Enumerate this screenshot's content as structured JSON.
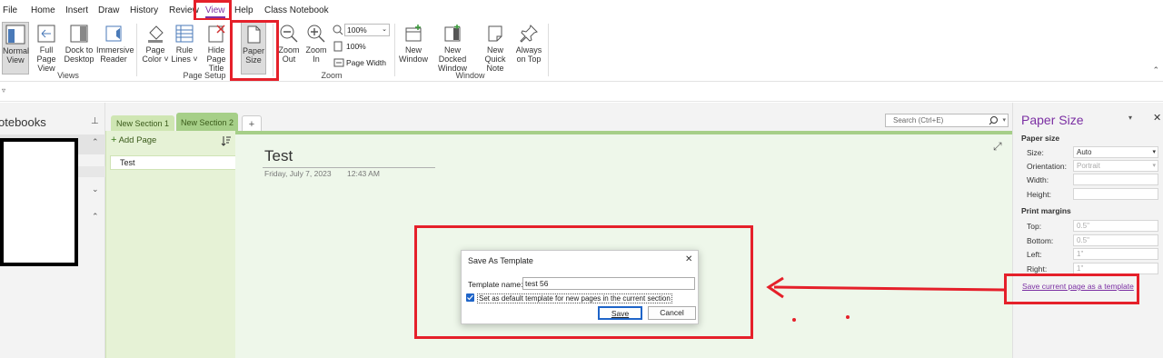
{
  "menu": {
    "items": [
      "File",
      "Home",
      "Insert",
      "Draw",
      "History",
      "Review",
      "View",
      "Help",
      "Class Notebook"
    ],
    "active": "View"
  },
  "ribbon": {
    "views": {
      "label": "Views",
      "normal": [
        "Normal",
        "View"
      ],
      "full_page": [
        "Full Page",
        "View"
      ],
      "dock": [
        "Dock to",
        "Desktop"
      ],
      "immersive": [
        "Immersive",
        "Reader"
      ]
    },
    "page_setup": {
      "label": "Page Setup",
      "page_color": [
        "Page",
        "Color ˅"
      ],
      "rule_lines": [
        "Rule",
        "Lines ˅"
      ],
      "hide_title": [
        "Hide",
        "Page Title"
      ],
      "paper_size": [
        "Paper",
        "Size"
      ]
    },
    "zoom": {
      "label": "Zoom",
      "zoom_out": [
        "Zoom",
        "Out"
      ],
      "zoom_in": [
        "Zoom",
        "In"
      ],
      "zoom_value": "100%",
      "hundred": "100%",
      "page_width": "Page Width"
    },
    "window": {
      "label": "Window",
      "new_window": [
        "New",
        "Window"
      ],
      "new_docked": [
        "New Docked",
        "Window"
      ],
      "quick_note": [
        "New Quick",
        "Note"
      ],
      "always_top": [
        "Always",
        "on Top"
      ]
    }
  },
  "notebooks_title": "otebooks",
  "sections": {
    "tabs": [
      "New Section 1",
      "New Section 2"
    ],
    "add_tab": "+",
    "active_index": 1
  },
  "search": {
    "placeholder": "Search (Ctrl+E)"
  },
  "pages": {
    "add_page": "Add Page",
    "items": [
      "Test"
    ]
  },
  "page": {
    "title": "Test",
    "date": "Friday, July 7, 2023",
    "time": "12:43 AM"
  },
  "paper_size_pane": {
    "title": "Paper Size",
    "paper_size_heading": "Paper size",
    "size_label": "Size:",
    "size_value": "Auto",
    "orientation_label": "Orientation:",
    "orientation_value": "Portrait",
    "width_label": "Width:",
    "height_label": "Height:",
    "print_margins_heading": "Print margins",
    "top_label": "Top:",
    "top_value": "0.5\"",
    "bottom_label": "Bottom:",
    "bottom_value": "0.5\"",
    "left_label": "Left:",
    "left_value": "1\"",
    "right_label": "Right:",
    "right_value": "1\"",
    "save_link": "Save current page as a template"
  },
  "dialog": {
    "title": "Save As Template",
    "template_name_label": "Template name:",
    "template_name_value": "test 56",
    "checkbox_label": "Set as default template for new pages in the current section",
    "checkbox_checked": true,
    "save_button": "Save",
    "cancel_button": "Cancel"
  },
  "colors": {
    "annotation_red": "#e5202a",
    "accent_purple": "#7b2fa3",
    "section_green": "#a6cf88"
  }
}
